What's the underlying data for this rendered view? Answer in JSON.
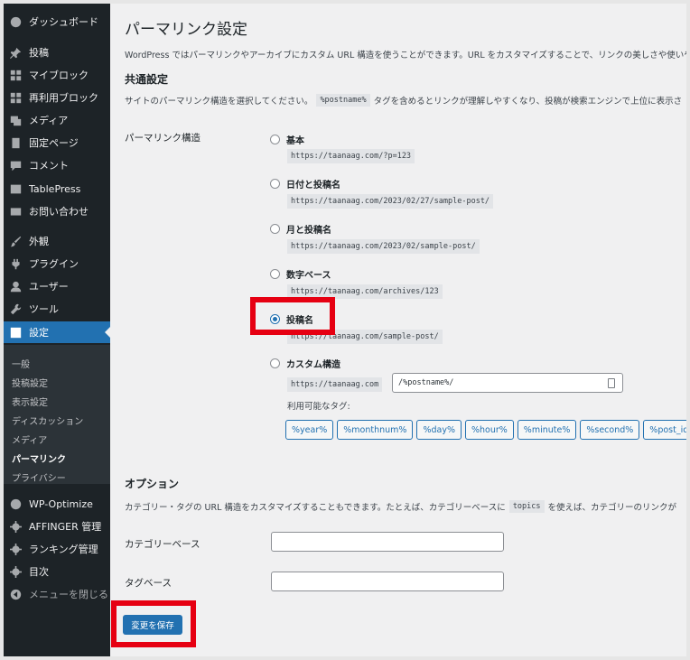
{
  "sidebar": {
    "dashboard": "ダッシュボード",
    "posts": "投稿",
    "my_blocks": "マイブロック",
    "reusable_blocks": "再利用ブロック",
    "media": "メディア",
    "pages": "固定ページ",
    "comments": "コメント",
    "tablepress": "TablePress",
    "contact": "お問い合わせ",
    "appearance": "外観",
    "plugins": "プラグイン",
    "users": "ユーザー",
    "tools": "ツール",
    "settings": "設定",
    "submenu": [
      "一般",
      "投稿設定",
      "表示設定",
      "ディスカッション",
      "メディア",
      "パーマリンク",
      "プライバシー"
    ],
    "wp_optimize": "WP-Optimize",
    "affinger": "AFFINGER 管理",
    "ranking": "ランキング管理",
    "toc": "目次",
    "collapse": "メニューを閉じる"
  },
  "main": {
    "title": "パーマリンク設定",
    "intro": "WordPress ではパーマリンクやアーカイブにカスタム URL 構造を使うことができます。URL をカスタマイズすることで、リンクの美しさや使いや",
    "common_heading": "共通設定",
    "common_desc_pre": "サイトのパーマリンク構造を選択してください。",
    "common_desc_code": "%postname%",
    "common_desc_post": "タグを含めるとリンクが理解しやすくなり、投稿が検索エンジンで上位に表示さ",
    "structure_label": "パーマリンク構造",
    "options": [
      {
        "label": "基本",
        "url": "https://taanaag.com/?p=123",
        "checked": false
      },
      {
        "label": "日付と投稿名",
        "url": "https://taanaag.com/2023/02/27/sample-post/",
        "checked": false
      },
      {
        "label": "月と投稿名",
        "url": "https://taanaag.com/2023/02/sample-post/",
        "checked": false
      },
      {
        "label": "数字ベース",
        "url": "https://taanaag.com/archives/123",
        "checked": false
      },
      {
        "label": "投稿名",
        "url": "https://taanaag.com/sample-post/",
        "checked": true
      }
    ],
    "custom_label": "カスタム構造",
    "custom_prefix": "https://taanaag.com",
    "custom_value": "/%postname%/",
    "available_tags_label": "利用可能なタグ:",
    "tags": [
      "%year%",
      "%monthnum%",
      "%day%",
      "%hour%",
      "%minute%",
      "%second%",
      "%post_id%"
    ],
    "options_heading": "オプション",
    "options_desc_pre": "カテゴリー・タグの URL 構造をカスタマイズすることもできます。たとえば、カテゴリーベースに",
    "options_desc_code": "topics",
    "options_desc_post": "を使えば、カテゴリーのリンクが",
    "category_base_label": "カテゴリーベース",
    "tag_base_label": "タグベース",
    "category_base_value": "",
    "tag_base_value": "",
    "save_label": "変更を保存"
  },
  "colors": {
    "sidebar_bg": "#1d2327",
    "active": "#2271b1",
    "highlight": "#e60012"
  }
}
